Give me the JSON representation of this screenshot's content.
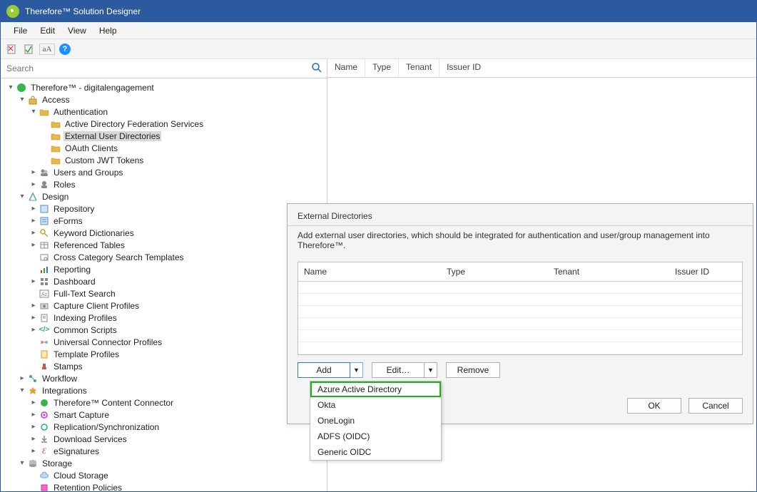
{
  "window": {
    "title": "Therefore™ Solution Designer"
  },
  "menu": {
    "file": "File",
    "edit": "Edit",
    "view": "View",
    "help": "Help"
  },
  "toolbar": {
    "aa": "aA"
  },
  "search": {
    "placeholder": "Search"
  },
  "right_header": {
    "name": "Name",
    "type": "Type",
    "tenant": "Tenant",
    "issuer": "Issuer ID"
  },
  "tree": {
    "root": "Therefore™ - digitalengagement",
    "access": "Access",
    "auth": "Authentication",
    "adfs": "Active Directory Federation Services",
    "extdirs": "External User Directories",
    "oauth": "OAuth Clients",
    "jwt": "Custom JWT Tokens",
    "users": "Users and Groups",
    "roles": "Roles",
    "design": "Design",
    "repo": "Repository",
    "eforms": "eForms",
    "kw": "Keyword Dictionaries",
    "reftables": "Referenced Tables",
    "ccsearch": "Cross Category Search Templates",
    "reporting": "Reporting",
    "dashboard": "Dashboard",
    "fts": "Full-Text Search",
    "capture": "Capture Client Profiles",
    "indexing": "Indexing Profiles",
    "commonscripts": "Common Scripts",
    "ucprof": "Universal Connector Profiles",
    "tmplprof": "Template Profiles",
    "stamps": "Stamps",
    "workflow": "Workflow",
    "integrations": "Integrations",
    "tcc": "Therefore™ Content Connector",
    "smartcap": "Smart Capture",
    "replsync": "Replication/Synchronization",
    "dlsvc": "Download Services",
    "esig": "eSignatures",
    "storage": "Storage",
    "cloudstorage": "Cloud Storage",
    "retention": "Retention Policies"
  },
  "dialog": {
    "title": "External Directories",
    "desc": "Add external user directories, which should be integrated for authentication and user/group management into Therefore™.",
    "cols": {
      "name": "Name",
      "type": "Type",
      "tenant": "Tenant",
      "issuer": "Issuer ID"
    },
    "buttons": {
      "add": "Add",
      "edit": "Edit…",
      "remove": "Remove",
      "ok": "OK",
      "cancel": "Cancel"
    }
  },
  "dropdown": {
    "aad": "Azure Active Directory",
    "okta": "Okta",
    "onelogin": "OneLogin",
    "adfsoidc": "ADFS (OIDC)",
    "generic": "Generic OIDC"
  }
}
